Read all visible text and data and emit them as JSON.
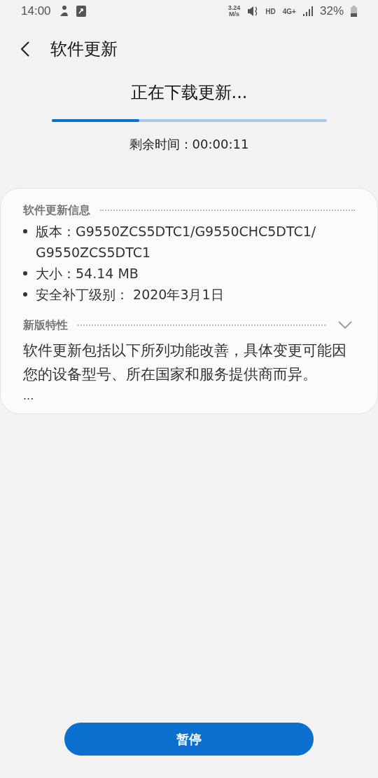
{
  "status_bar": {
    "time": "14:00",
    "speed": "3.24",
    "speed_unit": "M/s",
    "hd": "HD",
    "network": "4G+",
    "battery": "32%"
  },
  "header": {
    "title": "软件更新"
  },
  "download": {
    "title": "正在下载更新...",
    "level": 0.32,
    "remaining": "剩余时间：00:00:11"
  },
  "info": {
    "heading": "软件更新信息",
    "items": [
      {
        "text": "版本：G9550ZCS5DTC1/G9550CHC5DTC1/\nG9550ZCS5DTC1"
      },
      {
        "text": "大小：54.14 MB"
      },
      {
        "text": "安全补丁级别： 2020年3月1日"
      }
    ]
  },
  "features": {
    "heading": "新版特性",
    "expanded": false,
    "text": "软件更新包括以下所列功能改善，具体变更可能因您的设备型号、所在国家和服务提供商而异。",
    "more": "..."
  },
  "buttons": [
    {
      "label": "暂停",
      "kind": "primary"
    }
  ]
}
